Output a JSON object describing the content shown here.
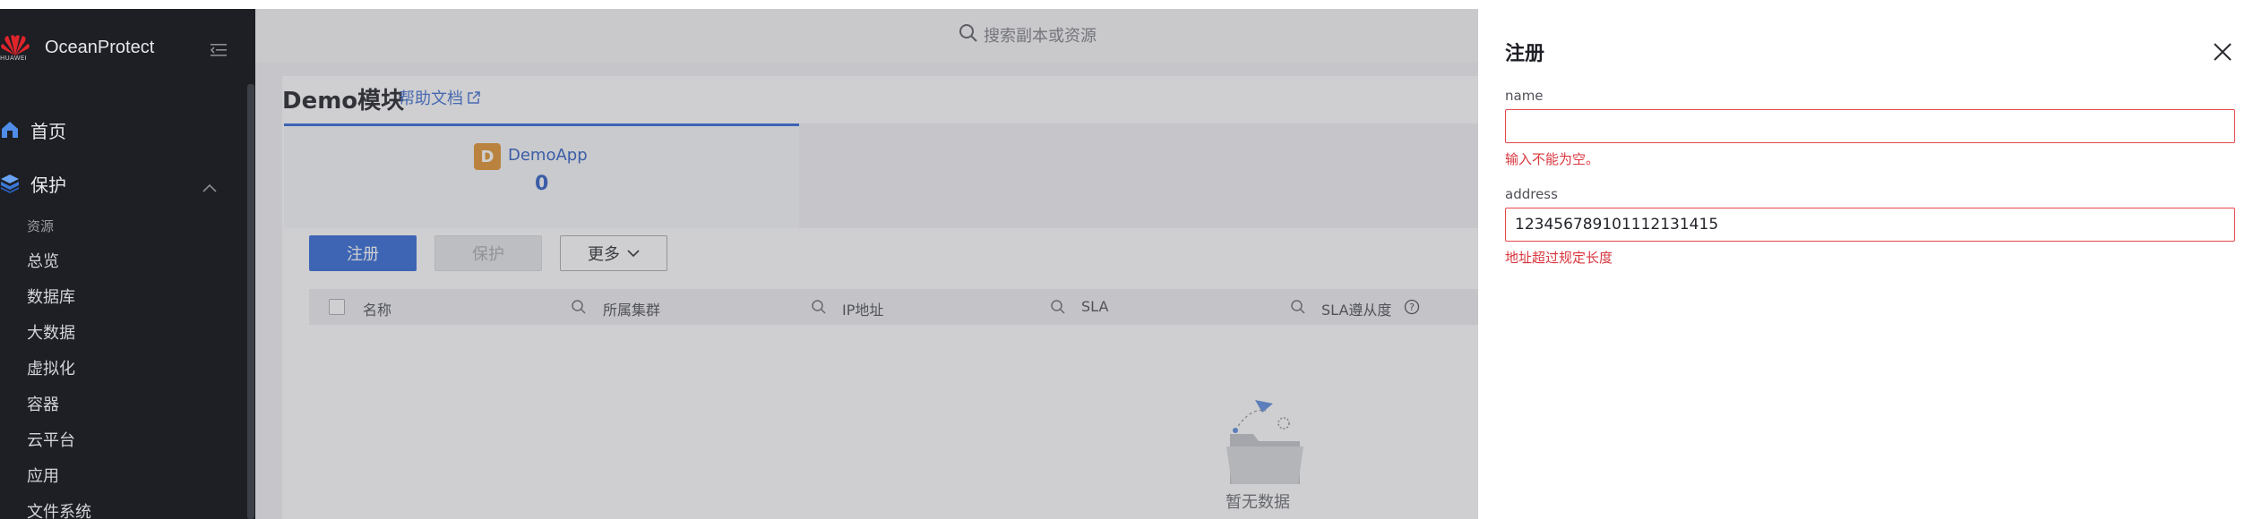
{
  "brand": {
    "logo_text": "HUAWEI",
    "product": "OceanProtect"
  },
  "sidebar": {
    "home_label": "首页",
    "protect_label": "保护",
    "section_label": "资源",
    "items": [
      "总览",
      "数据库",
      "大数据",
      "虚拟化",
      "容器",
      "云平台",
      "应用",
      "文件系统"
    ]
  },
  "topbar": {
    "search_placeholder": "搜索副本或资源"
  },
  "page": {
    "title": "Demo模块",
    "help_link": "帮助文档"
  },
  "app_tab": {
    "badge_letter": "D",
    "name": "DemoApp",
    "count": "0"
  },
  "toolbar": {
    "register": "注册",
    "protect": "保护",
    "more": "更多"
  },
  "table": {
    "columns": [
      "名称",
      "所属集群",
      "IP地址",
      "SLA",
      "SLA遵从度"
    ],
    "empty_text": "暂无数据"
  },
  "drawer": {
    "title": "注册",
    "fields": [
      {
        "label": "name",
        "value": "",
        "error": "输入不能为空。"
      },
      {
        "label": "address",
        "value": "123456789101112131415",
        "error": "地址超过规定长度"
      }
    ]
  },
  "colors": {
    "accent": "#2e68d6",
    "error": "#d9363e",
    "sidebar_bg": "#1d1f24",
    "app_badge": "#e0922f"
  },
  "icons": [
    "huawei-logo-icon",
    "collapse-menu-icon",
    "home-icon",
    "protect-icon",
    "chevron-up-icon",
    "search-icon",
    "external-link-icon",
    "chevron-down-icon",
    "help-circle-icon",
    "empty-folder-icon",
    "close-icon"
  ]
}
